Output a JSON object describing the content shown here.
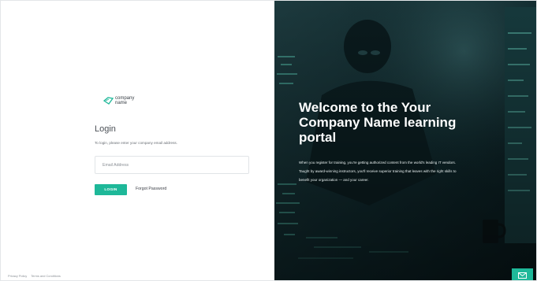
{
  "logo": {
    "text_line1": "company",
    "text_line2": "name",
    "icon": "leaf-logo-icon"
  },
  "login": {
    "title": "Login",
    "subtitle": "To login, please enter your company email address.",
    "email_placeholder": "Email Address",
    "email_value": "",
    "login_button": "LOGIN",
    "forgot_link": "Forgot Password"
  },
  "footer": {
    "privacy": "Privacy Policy",
    "terms": "Terms and Conditions"
  },
  "hero": {
    "title": "Welcome to the Your Company Name learning portal",
    "body": "When you register for training, you're getting authorized content from the world's leading IT vendors. Taught by award-winning instructors, you'll receive superior training that leaves with the right skills to benefit your organization — and your career.",
    "image": "person-at-computer-dark-photo"
  },
  "chat": {
    "icon": "envelope-icon"
  },
  "colors": {
    "accent": "#1eb899",
    "hero_bg": "#0d2428",
    "text_dark": "#3a4047"
  }
}
